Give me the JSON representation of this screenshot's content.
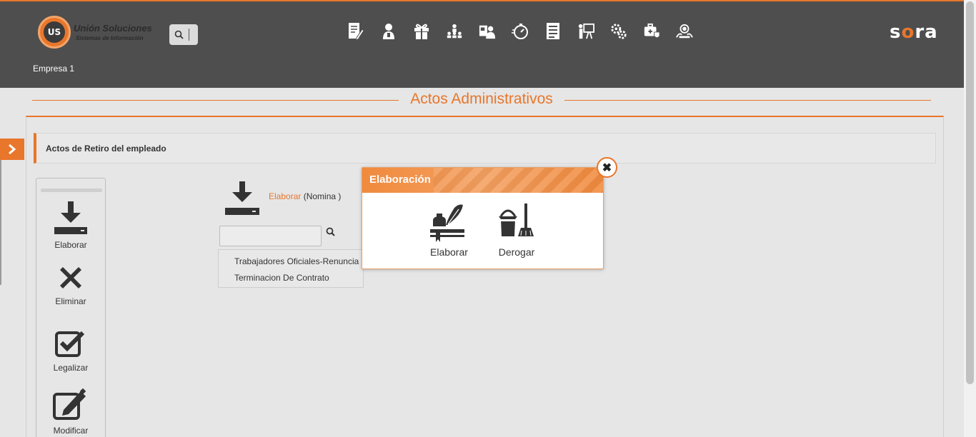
{
  "header": {
    "logo_title": "Unión Soluciones",
    "logo_subtitle": "Sistemas de Información",
    "logo_badge": "US",
    "brand": {
      "pre": "s",
      "accent": "o",
      "post": "ra"
    },
    "company": "Empresa 1",
    "module_icons": [
      "document-edit-icon",
      "employee-icon",
      "gift-icon",
      "hierarchy-icon",
      "user-card-icon",
      "stopwatch-icon",
      "report-list-icon",
      "presentation-icon",
      "gears-icon",
      "medical-bag-icon",
      "support-team-icon"
    ]
  },
  "page": {
    "title": "Actos Administrativos",
    "section": "Actos de Retiro del empleado"
  },
  "actions": [
    {
      "label": "Elaborar",
      "icon": "download-tray-icon"
    },
    {
      "label": "Eliminar",
      "icon": "x-icon"
    },
    {
      "label": "Legalizar",
      "icon": "checkbox-icon"
    },
    {
      "label": "Modificar",
      "icon": "edit-square-icon"
    }
  ],
  "elaborar": {
    "link_label": "Elaborar",
    "context": "(Nomina )",
    "filter_value": "",
    "items": [
      "Trabajadores Oficiales-Renuncia",
      "Terminacion De Contrato"
    ]
  },
  "popup": {
    "title": "Elaboración",
    "options": [
      {
        "label": "Elaborar",
        "icon": "ink-quill-icon"
      },
      {
        "label": "Derogar",
        "icon": "bucket-broom-icon"
      }
    ]
  },
  "colors": {
    "accent": "#e8762b",
    "header_bg": "#4e4e4e",
    "page_bg": "#e6e6e6"
  }
}
